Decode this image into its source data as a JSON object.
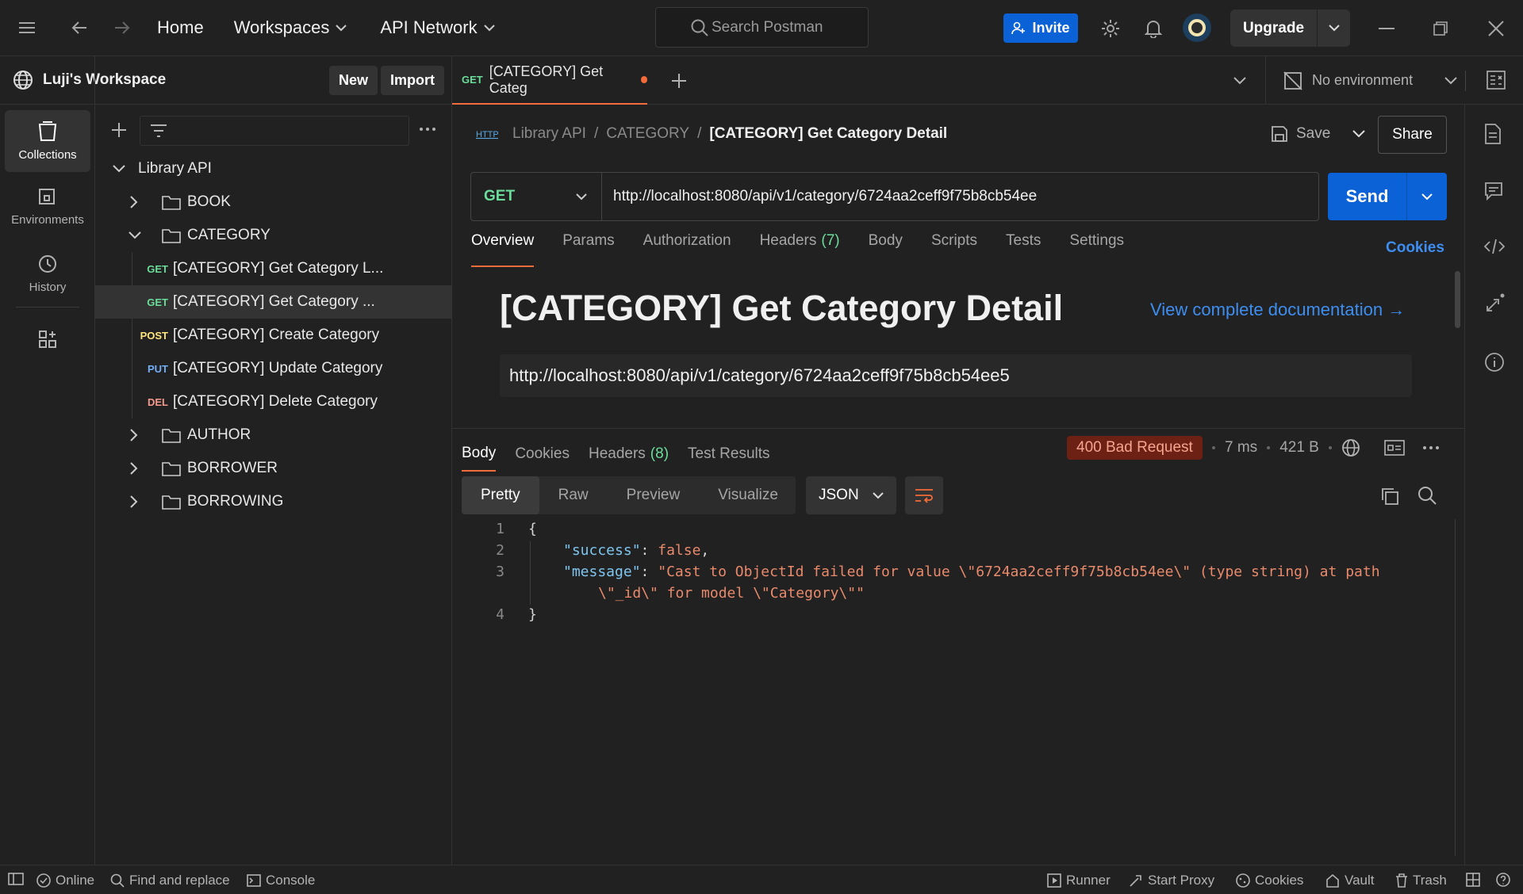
{
  "topbar": {
    "home": "Home",
    "workspaces": "Workspaces",
    "api_network": "API Network",
    "search_placeholder": "Search Postman",
    "invite": "Invite",
    "upgrade": "Upgrade"
  },
  "workspace": {
    "name": "Luji's Workspace",
    "new_btn": "New",
    "import_btn": "Import"
  },
  "rail": [
    {
      "label": "Collections",
      "icon": "collections-icon"
    },
    {
      "label": "Environments",
      "icon": "environments-icon"
    },
    {
      "label": "History",
      "icon": "history-icon"
    }
  ],
  "tree": {
    "collection": "Library API",
    "folders": {
      "book": "BOOK",
      "category": "CATEGORY",
      "author": "AUTHOR",
      "borrower": "BORROWER",
      "borrowing": "BORROWING"
    },
    "requests": [
      {
        "method": "GET",
        "name": "[CATEGORY] Get Category L..."
      },
      {
        "method": "GET",
        "name": "[CATEGORY] Get Category ..."
      },
      {
        "method": "POST",
        "name": "[CATEGORY] Create Category"
      },
      {
        "method": "PUT",
        "name": "[CATEGORY] Update Category"
      },
      {
        "method": "DEL",
        "name": "[CATEGORY] Delete Category"
      }
    ]
  },
  "tab": {
    "method": "GET",
    "title": "[CATEGORY] Get Categ"
  },
  "environment": "No environment",
  "breadcrumb": {
    "collection": "Library API",
    "folder": "CATEGORY",
    "current": "[CATEGORY] Get Category Detail",
    "sep": "/"
  },
  "actions": {
    "save": "Save",
    "share": "Share",
    "send": "Send"
  },
  "request": {
    "method": "GET",
    "url": "http://localhost:8080/api/v1/category/6724aa2ceff9f75b8cb54ee",
    "tabs": {
      "overview": "Overview",
      "params": "Params",
      "authorization": "Authorization",
      "headers": "Headers",
      "headers_count": "(7)",
      "body": "Body",
      "scripts": "Scripts",
      "tests": "Tests",
      "settings": "Settings"
    },
    "cookies": "Cookies"
  },
  "docs": {
    "title": "[CATEGORY] Get Category Detail",
    "link": "View complete documentation →",
    "url": "http://localhost:8080/api/v1/category/6724aa2ceff9f75b8cb54ee5"
  },
  "response": {
    "tabs": {
      "body": "Body",
      "cookies": "Cookies",
      "headers": "Headers",
      "headers_count": "(8)",
      "test_results": "Test Results"
    },
    "status": "400 Bad Request",
    "time": "7 ms",
    "size": "421 B",
    "formats": {
      "pretty": "Pretty",
      "raw": "Raw",
      "preview": "Preview",
      "visualize": "Visualize"
    },
    "language": "JSON",
    "code": {
      "l1": "{",
      "l2_key": "\"success\"",
      "l2_val": "false",
      "l3_key": "\"message\"",
      "l3_val": "\"Cast to ObjectId failed for value \\\"6724aa2ceff9f75b8cb54ee\\\" (type string) at path",
      "l3_cont": "\\\"_id\\\" for model \\\"Category\\\"\"",
      "l4": "}",
      "line_numbers": [
        "1",
        "2",
        "3",
        "4"
      ]
    }
  },
  "statusbar": {
    "online": "Online",
    "find_replace": "Find and replace",
    "console": "Console",
    "runner": "Runner",
    "start_proxy": "Start Proxy",
    "cookies": "Cookies",
    "vault": "Vault",
    "trash": "Trash"
  },
  "colors": {
    "accent": "#f26b3a",
    "primary_blue": "#0b61d6",
    "get": "#6bdd9a",
    "post": "#ffe47e",
    "put": "#74aef6",
    "delete": "#f79a8e",
    "error_bg": "#6d2014"
  }
}
